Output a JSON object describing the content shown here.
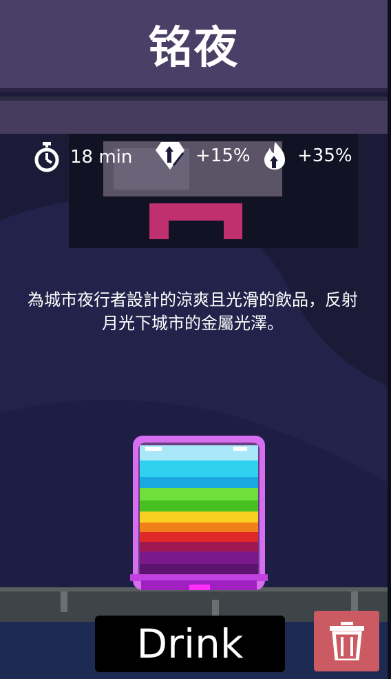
{
  "header": {
    "title": "铭夜"
  },
  "stats": {
    "time": {
      "icon": "stopwatch-icon",
      "value": "18 min"
    },
    "boost_one": {
      "icon": "diamond-up-icon",
      "value": "+15%"
    },
    "boost_two": {
      "icon": "flame-up-icon",
      "value": "+35%"
    }
  },
  "description": "為城市夜行者設計的涼爽且光滑的飲品，反射月光下城市的金屬光澤。",
  "actions": {
    "drink_label": "Drink",
    "delete_icon": "trash-icon"
  },
  "colors": {
    "accent": "#cc5a62",
    "header": "#4a3f66",
    "background": "#1b1b38"
  }
}
